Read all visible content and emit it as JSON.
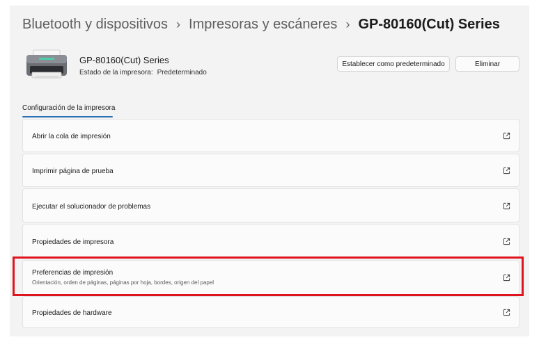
{
  "breadcrumb": {
    "items": [
      "Bluetooth y dispositivos",
      "Impresoras y escáneres"
    ],
    "current": "GP-80160(Cut) Series",
    "separator": "›"
  },
  "printer": {
    "name": "GP-80160(Cut) Series",
    "status_label": "Estado de la impresora:",
    "status_value": "Predeterminado",
    "icon": "printer-icon"
  },
  "actions": {
    "set_default_label": "Establecer como predeterminado",
    "remove_label": "Eliminar"
  },
  "tab": {
    "label": "Configuración de la impresora"
  },
  "settings": [
    {
      "label": "Abrir la cola de impresión",
      "icon": "open-external-icon"
    },
    {
      "label": "Imprimir página de prueba",
      "icon": "open-external-icon"
    },
    {
      "label": "Ejecutar el solucionador de problemas",
      "icon": "open-external-icon"
    },
    {
      "label": "Propiedades de impresora",
      "icon": "open-external-icon"
    },
    {
      "label": "Preferencias de impresión",
      "description": "Orientación, orden de páginas, páginas por hoja, bordes, origen del papel",
      "icon": "open-external-icon"
    },
    {
      "label": "Propiedades de hardware",
      "icon": "open-external-icon"
    }
  ],
  "colors": {
    "accent": "#2a6fb5",
    "highlight": "#e0141e",
    "panel_bg": "#f3f3f3"
  }
}
